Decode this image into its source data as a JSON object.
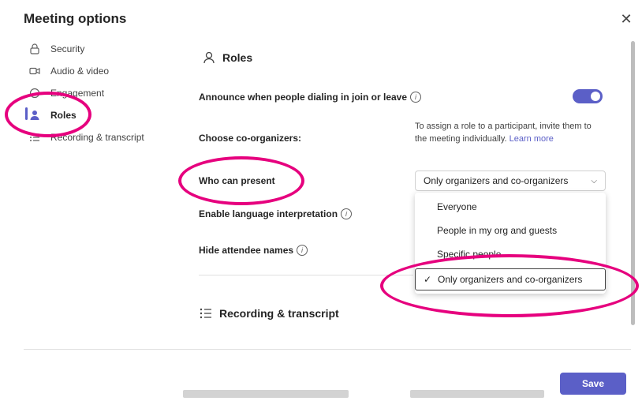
{
  "dialog": {
    "title": "Meeting options"
  },
  "nav": {
    "items": [
      {
        "label": "Security",
        "icon": "lock-icon"
      },
      {
        "label": "Audio & video",
        "icon": "camera-icon"
      },
      {
        "label": "Engagement",
        "icon": "engagement-icon"
      },
      {
        "label": "Roles",
        "icon": "person-icon",
        "active": true
      },
      {
        "label": "Recording & transcript",
        "icon": "list-icon"
      }
    ]
  },
  "roles": {
    "heading": "Roles",
    "announce_label": "Announce when people dialing in join or leave",
    "announce_toggle_on": true,
    "co_organizers_label": "Choose co-organizers:",
    "co_organizers_hint": "To assign a role to a participant, invite them to the meeting individually.",
    "co_organizers_link": "Learn more",
    "who_can_present_label": "Who can present",
    "who_can_present_value": "Only organizers and co-organizers",
    "language_label": "Enable language interpretation",
    "hide_names_label": "Hide attendee names",
    "options": [
      "Everyone",
      "People in my org and guests",
      "Specific people",
      "Only organizers and co-organizers"
    ],
    "selected_option_index": 3
  },
  "recording": {
    "heading": "Recording & transcript"
  },
  "footer": {
    "save_label": "Save"
  },
  "colors": {
    "accent": "#5b5fc7",
    "highlight": "#e6007e"
  }
}
